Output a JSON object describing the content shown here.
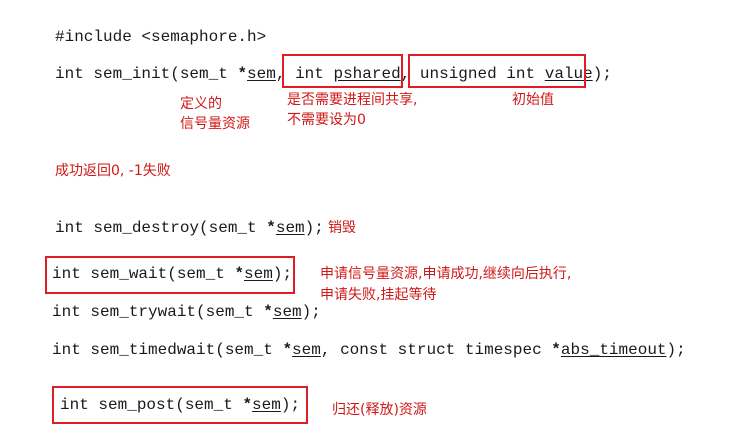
{
  "code": {
    "include": "#include <semaphore.h>",
    "init": {
      "a": "int sem_init(sem_t ",
      "star1": "*",
      "p1": "sem",
      "c1": ", ",
      "t2": "int ",
      "p2": "pshared",
      "c2": ", ",
      "t3": "unsigned int ",
      "p3": "value",
      "end": ");"
    },
    "destroy": {
      "a": "int sem_destroy(sem_t ",
      "star": "*",
      "p": "sem",
      "end": ");"
    },
    "wait": {
      "a": "int sem_wait(sem_t ",
      "star": "*",
      "p": "sem",
      "end": ");"
    },
    "trywait": {
      "a": "int sem_trywait(sem_t ",
      "star": "*",
      "p": "sem",
      "end": ");"
    },
    "timedwait": {
      "a": "int sem_timedwait(sem_t ",
      "star1": "*",
      "p1": "sem",
      "mid": ", const struct timespec ",
      "star2": "*",
      "p2": "abs_timeout",
      "end": ");"
    },
    "post": {
      "a": "int sem_post(sem_t ",
      "star": "*",
      "p": "sem",
      "end": ");"
    }
  },
  "notes": {
    "sem_define_1": "定义的",
    "sem_define_2": "信号量资源",
    "pshared_1": "是否需要进程间共享,",
    "pshared_2": "不需要设为0",
    "value": "初始值",
    "init_return": "成功返回0, -1失败",
    "destroy": "销毁",
    "wait_1": "申请信号量资源,申请成功,继续向后执行,",
    "wait_2": "申请失败,挂起等待",
    "post": "归还(释放)资源"
  },
  "colors": {
    "annotation": "#d01818",
    "box": "#e01d24"
  }
}
